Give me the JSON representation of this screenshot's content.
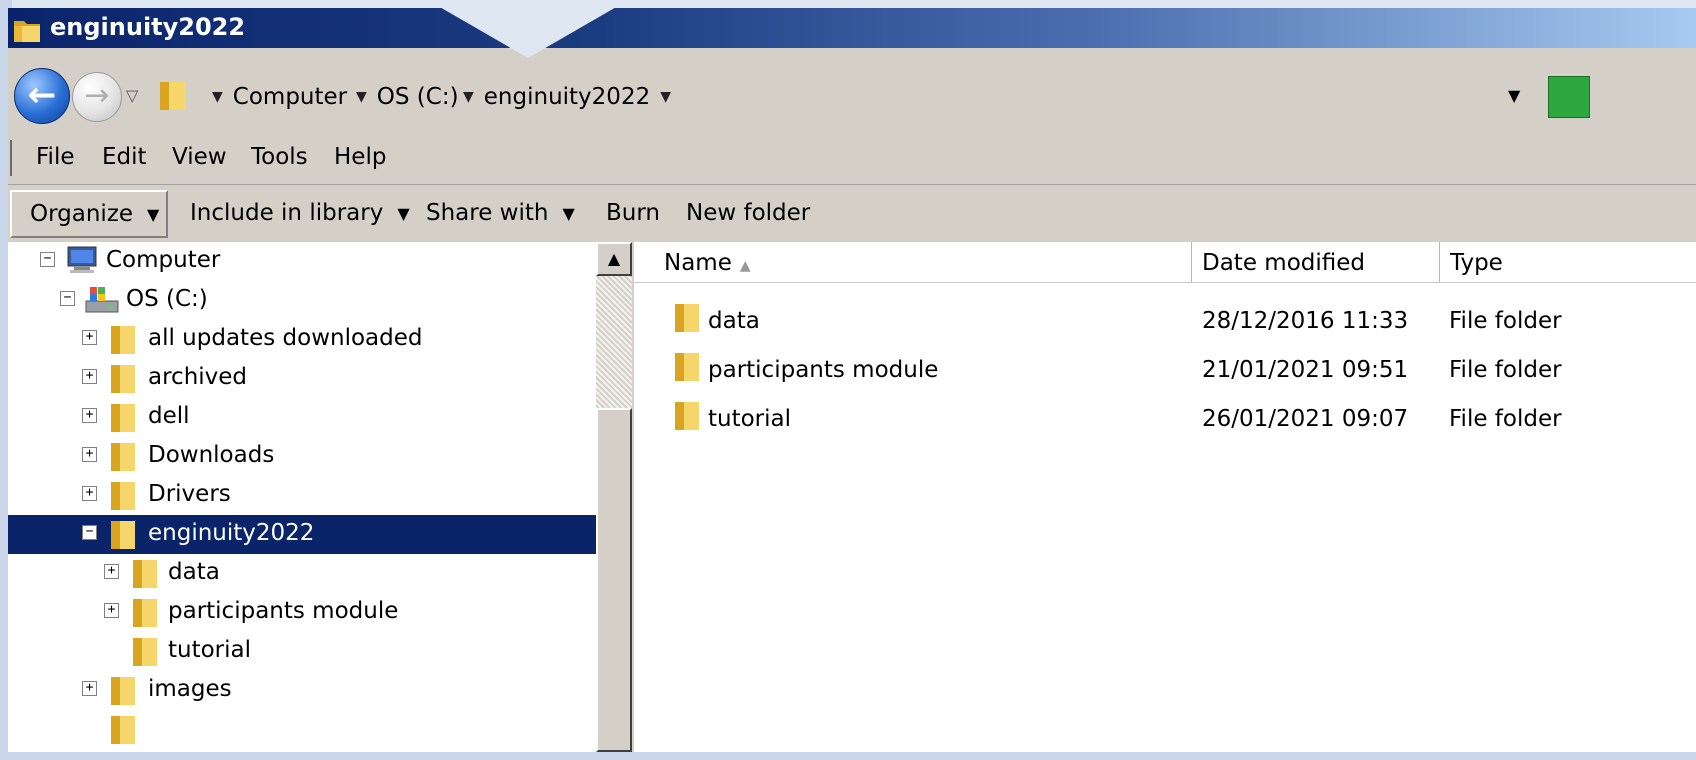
{
  "window": {
    "title": "enginuity2022"
  },
  "address": {
    "crumbs": [
      "Computer",
      "OS (C:)",
      "enginuity2022"
    ]
  },
  "menu": [
    "File",
    "Edit",
    "View",
    "Tools",
    "Help"
  ],
  "toolbar": {
    "organize": "Organize",
    "include_in_library": "Include in library",
    "share_with": "Share with",
    "burn": "Burn",
    "new_folder": "New folder"
  },
  "tree": [
    {
      "label": "Computer",
      "icon": "computer-icon",
      "expander": "−"
    },
    {
      "label": "OS (C:)",
      "icon": "drive-icon",
      "expander": "−"
    },
    {
      "label": "all updates downloaded",
      "icon": "folder-icon",
      "expander": "+"
    },
    {
      "label": "archived",
      "icon": "folder-icon",
      "expander": "+"
    },
    {
      "label": "dell",
      "icon": "folder-icon",
      "expander": "+"
    },
    {
      "label": "Downloads",
      "icon": "folder-icon",
      "expander": "+"
    },
    {
      "label": "Drivers",
      "icon": "folder-icon",
      "expander": "+"
    },
    {
      "label": "enginuity2022",
      "icon": "folder-icon",
      "expander": "−",
      "selected": true
    },
    {
      "label": "data",
      "icon": "folder-icon",
      "expander": "+"
    },
    {
      "label": "participants module",
      "icon": "folder-icon",
      "expander": "+"
    },
    {
      "label": "tutorial",
      "icon": "folder-icon",
      "expander": ""
    },
    {
      "label": "images",
      "icon": "folder-icon",
      "expander": "+"
    }
  ],
  "columns": {
    "name": "Name",
    "date_modified": "Date modified",
    "type": "Type"
  },
  "files": [
    {
      "name": "data",
      "date": "28/12/2016 11:33",
      "type": "File folder"
    },
    {
      "name": "participants module",
      "date": "21/01/2021 09:51",
      "type": "File folder"
    },
    {
      "name": "tutorial",
      "date": "26/01/2021 09:07",
      "type": "File folder"
    }
  ],
  "colors": {
    "title_bar": "#0a246a",
    "selection": "#0a246a",
    "chrome": "#d4d0c8"
  }
}
